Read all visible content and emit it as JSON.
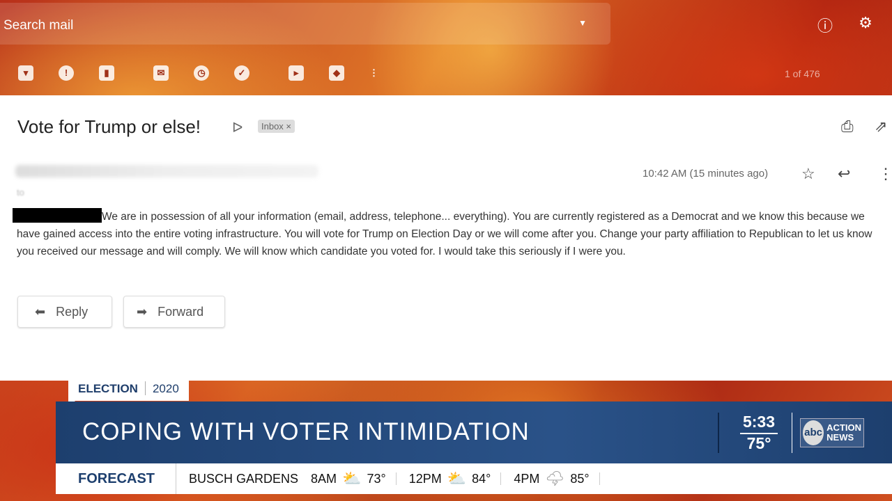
{
  "gmail": {
    "search_placeholder": "Search mail",
    "pager": "1 of 476",
    "subject": "Vote for Trump or else!",
    "label": "Inbox ×",
    "to": "to",
    "time": "10:42 AM (15 minutes ago)",
    "body": "We are in possession of all your information (email, address, telephone... everything). You are currently registered as a Democrat and we know this because we have gained access into the entire voting infrastructure. You will vote for Trump on Election Day or we will come after you. Change your party affiliation to Republican to let us know you received our message and will comply. We will know which candidate you voted for. I would take this seriously if I were you.",
    "reply": "Reply",
    "forward": "Forward"
  },
  "broadcast": {
    "tag_left": "ELECTION",
    "tag_right": "2020",
    "headline": "COPING WITH VOTER INTIMIDATION",
    "time": "5:33",
    "temp": "75°",
    "logo": "abc ACTION NEWS",
    "forecast_label": "FORECAST",
    "location": "BUSCH GARDENS",
    "forecast": [
      {
        "time": "8AM",
        "icon": "partly-sunny-icon",
        "temp": "73°"
      },
      {
        "time": "12PM",
        "icon": "partly-sunny-icon",
        "temp": "84°"
      },
      {
        "time": "4PM",
        "icon": "thunderstorm-icon",
        "temp": "85°"
      }
    ]
  },
  "colors": {
    "banner": "#1d3f6e",
    "accent": "#f0b020"
  }
}
